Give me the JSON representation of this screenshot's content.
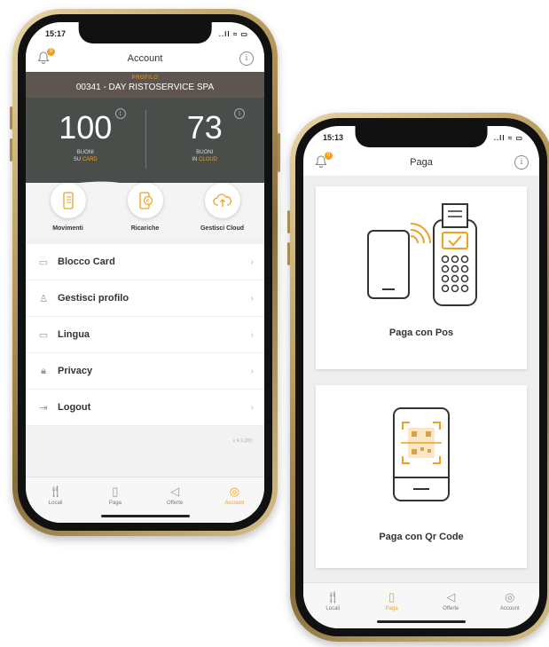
{
  "account_screen": {
    "status_time": "15:17",
    "status_icons": "..ll ≈ ▭",
    "bell_badge": "0",
    "title": "Account",
    "info_glyph": "i",
    "profile": {
      "label": "PROFILO",
      "name": "00341 - DAY RISTOSERVICE SPA"
    },
    "counters": [
      {
        "value": "100",
        "caption_line1": "BUONI",
        "caption_prefix": "SU ",
        "caption_highlight": "CARD"
      },
      {
        "value": "73",
        "caption_line1": "BUONI",
        "caption_prefix": "IN ",
        "caption_highlight": "CLOUD"
      }
    ],
    "actions": [
      {
        "label": "Movimenti",
        "icon": "list-phone-icon"
      },
      {
        "label": "Ricariche",
        "icon": "recharge-icon"
      },
      {
        "label": "Gestisci Cloud",
        "icon": "cloud-upload-icon"
      }
    ],
    "menu": [
      {
        "label": "Blocco Card",
        "icon": "card-icon"
      },
      {
        "label": "Gestisci profilo",
        "icon": "user-icon"
      },
      {
        "label": "Lingua",
        "icon": "chat-icon"
      },
      {
        "label": "Privacy",
        "icon": "lock-icon"
      },
      {
        "label": "Logout",
        "icon": "logout-icon"
      }
    ],
    "version": "v 4.1.(20)",
    "tabs": [
      {
        "label": "Locali",
        "icon": "cutlery-icon",
        "active": false
      },
      {
        "label": "Paga",
        "icon": "pay-icon",
        "active": false
      },
      {
        "label": "Offerte",
        "icon": "megaphone-icon",
        "active": false
      },
      {
        "label": "Account",
        "icon": "account-icon",
        "active": true
      }
    ]
  },
  "pay_screen": {
    "status_time": "15:13",
    "status_icons": "..ll ≈ ▭",
    "bell_badge": "0",
    "title": "Paga",
    "info_glyph": "i",
    "cards": [
      {
        "label": "Paga con Pos",
        "icon": "pos-terminal-icon"
      },
      {
        "label": "Paga con Qr Code",
        "icon": "qr-phone-icon"
      }
    ],
    "tabs": [
      {
        "label": "Locali",
        "icon": "cutlery-icon",
        "active": false
      },
      {
        "label": "Paga",
        "icon": "pay-icon",
        "active": true
      },
      {
        "label": "Offerte",
        "icon": "megaphone-icon",
        "active": false
      },
      {
        "label": "Account",
        "icon": "account-icon",
        "active": false
      }
    ]
  },
  "colors": {
    "accent": "#f0a020",
    "dark_panel": "#4a4e4a",
    "profile_bar": "#5e5550",
    "frame_gold": "#b89a5c"
  }
}
